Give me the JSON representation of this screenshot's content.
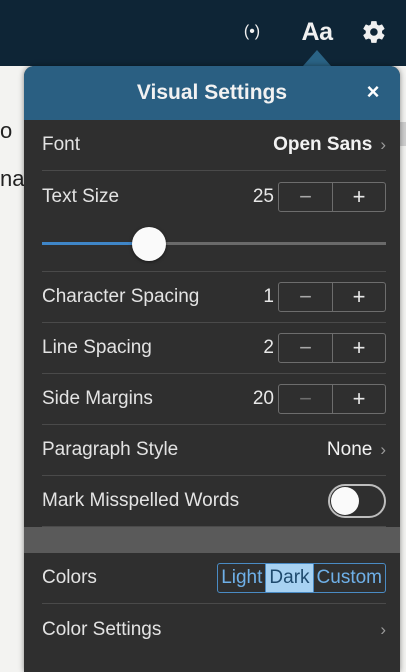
{
  "topbar": {
    "broadcast_icon": "(•)",
    "text_settings_label": "Aa",
    "settings_icon": "gear-icon"
  },
  "background_text": {
    "line1": "o",
    "line2": "na"
  },
  "panel": {
    "title": "Visual Settings",
    "close_label": "×",
    "font": {
      "label": "Font",
      "value": "Open Sans"
    },
    "text_size": {
      "label": "Text Size",
      "value": "25",
      "slider_fraction": 0.29
    },
    "character_spacing": {
      "label": "Character Spacing",
      "value": "1"
    },
    "line_spacing": {
      "label": "Line Spacing",
      "value": "2"
    },
    "side_margins": {
      "label": "Side Margins",
      "value": "20"
    },
    "paragraph_style": {
      "label": "Paragraph Style",
      "value": "None"
    },
    "mark_misspelled": {
      "label": "Mark Misspelled Words",
      "enabled": false
    },
    "colors": {
      "label": "Colors",
      "options": [
        "Light",
        "Dark",
        "Custom"
      ],
      "selected": "Dark"
    },
    "color_settings": {
      "label": "Color Settings"
    },
    "stepper": {
      "minus": "−",
      "plus": "+"
    },
    "chevron": "›"
  },
  "colors": {
    "topbar": "#0e2536",
    "header": "#2a5f82",
    "panel": "#2f2f2f",
    "accent": "#3f86c8"
  }
}
